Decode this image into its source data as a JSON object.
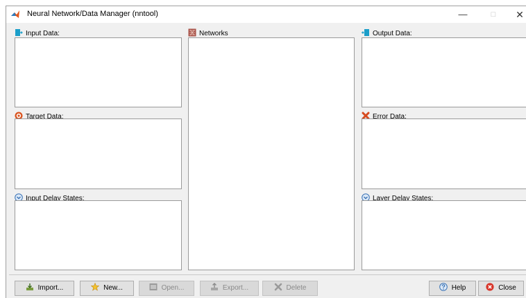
{
  "window": {
    "title": "Neural Network/Data Manager (nntool)",
    "minimize": "—",
    "maximize": "□",
    "close": "✕"
  },
  "panels": {
    "input_data": "Input Data:",
    "target_data": "Target Data:",
    "input_delay_states": "Input Delay States:",
    "networks": "Networks",
    "output_data": "Output Data:",
    "error_data": "Error Data:",
    "layer_delay_states": "Layer Delay States:"
  },
  "buttons": {
    "import": "Import...",
    "new": "New...",
    "open": "Open...",
    "export": "Export...",
    "delete": "Delete",
    "help": "Help",
    "close": "Close"
  },
  "icons": {
    "title": "matlab-logo-icon",
    "input_data": "input-data-icon",
    "target_data": "target-icon",
    "input_delay_states": "delay-states-icon",
    "networks": "network-icon",
    "output_data": "output-data-icon",
    "error_data": "error-icon",
    "layer_delay_states": "delay-states-icon"
  },
  "colors": {
    "window_bg": "#f0f0f0",
    "listbox_bg": "#ffffff",
    "disabled_text": "#8a8a8a"
  }
}
